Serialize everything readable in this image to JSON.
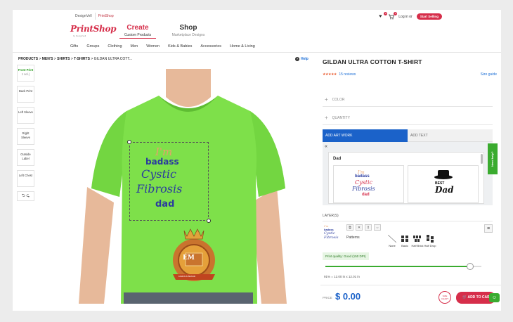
{
  "header": {
    "top_links": [
      "DesignVell",
      "PrintShop"
    ],
    "logo": "PrintShop",
    "logo_sub": "by DesignVell",
    "create_label": "Create",
    "create_sub": "Custom Products",
    "shop_label": "Shop",
    "shop_sub": "Marketplace Designs",
    "wishlist_count": "0",
    "cart_count": "0",
    "login": "Log in",
    "or": "or",
    "start_selling": "Start Selling"
  },
  "categories": [
    "Gifts",
    "Groups",
    "Clothing",
    "Men",
    "Women",
    "Kids & Babies",
    "Accessories",
    "Home & Living"
  ],
  "breadcrumb": {
    "items": [
      "PRODUCTS",
      "MEN'S",
      "SHIRTS",
      "T-SHIRTS",
      "GILDAN ULTRA COTT..."
    ],
    "separator": ">",
    "help": "Help"
  },
  "tools": {
    "front_print": "Front Print",
    "front_sub": "1 sel.)",
    "back_print": "Back Print",
    "left_sleeve": "Left Sleeve",
    "right_sleeve": "Right Sleeve",
    "outside_label": "Outside Label",
    "left_chest": "Left Chest",
    "undo": "⮌ ⮎"
  },
  "design": {
    "line1": "I'm",
    "line2": "badass",
    "line3": "Cystic",
    "line4": "Fibrosis",
    "line5": "dad",
    "emblem_initials": "EM",
    "emblem_ribbon": "FAMOUS BRAND"
  },
  "product": {
    "title": "GILDAN ULTRA COTTON T-SHIRT",
    "stars": "★★★★★",
    "reviews": "15 reviews",
    "size_guide": "Size guide",
    "color_label": "COLOR",
    "quantity_label": "QUANTITY"
  },
  "artwork": {
    "tab_add_artwork": "ADD ART WORK",
    "tab_add_text": "ADD TEXT",
    "back": "«",
    "category": "Dad",
    "thumb1_lines": [
      "I'm",
      "badass",
      "Cystic",
      "Fibrosis",
      "dad"
    ],
    "thumb2_lines": [
      "BEST",
      "Dad"
    ]
  },
  "feedback": "Need help?",
  "layers": {
    "label": "LAYER(S)",
    "patterns_label": "Patterns",
    "patterns": [
      "None",
      "Basic",
      "Half Brick",
      "Half Drop"
    ],
    "print_quality": "Print quality: Good (150 DPI)",
    "scale_value": 0.93,
    "scale_text": "91% = 12.00 in x 12.01 in"
  },
  "purchase": {
    "price_label": "PRICE",
    "price": "$ 0.00",
    "size_chart": "SIZE CHART",
    "add_to_cart": "ADD TO CART"
  },
  "colors": {
    "brand_red": "#d62e4a",
    "brand_blue": "#1b62c9",
    "shirt_green": "#7ee04a",
    "success_green": "#3aab2f"
  }
}
